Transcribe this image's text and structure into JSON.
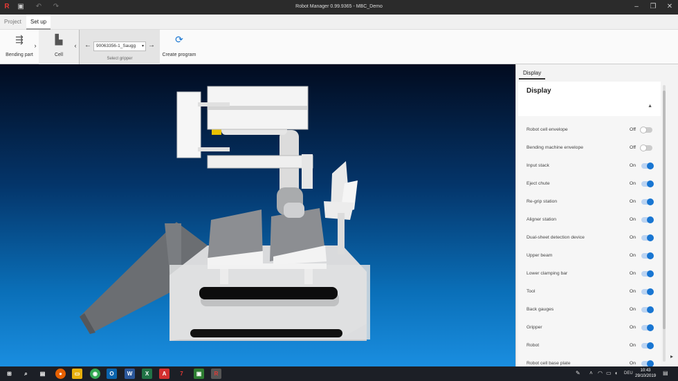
{
  "window": {
    "title": "Robot Manager 0.99.9365 - MBC_Demo"
  },
  "tabs": [
    {
      "label": "Project"
    },
    {
      "label": "Set up"
    }
  ],
  "ribbon": {
    "bending_part": "Bending part",
    "cell": "Cell",
    "gripper_value": "90063356-1_Saugg",
    "gripper_caption": "Select gripper",
    "create_program": "Create program"
  },
  "panel": {
    "tab": "Display",
    "title": "Display",
    "items": [
      {
        "label": "Robot cell envelope",
        "state": "Off",
        "on": false
      },
      {
        "label": "Bending machine envelope",
        "state": "Off",
        "on": false
      },
      {
        "label": "Input stack",
        "state": "On",
        "on": true
      },
      {
        "label": "Eject chute",
        "state": "On",
        "on": true
      },
      {
        "label": "Re-grip station",
        "state": "On",
        "on": true
      },
      {
        "label": "Aligner station",
        "state": "On",
        "on": true
      },
      {
        "label": "Dual-sheet detection device",
        "state": "On",
        "on": true
      },
      {
        "label": "Upper beam",
        "state": "On",
        "on": true
      },
      {
        "label": "Lower clamping bar",
        "state": "On",
        "on": true
      },
      {
        "label": "Tool",
        "state": "On",
        "on": true
      },
      {
        "label": "Back gauges",
        "state": "On",
        "on": true
      },
      {
        "label": "Gripper",
        "state": "On",
        "on": true
      },
      {
        "label": "Robot",
        "state": "On",
        "on": true
      },
      {
        "label": "Robot cell base plate",
        "state": "On",
        "on": true
      }
    ]
  },
  "taskbar": {
    "lang": "DEU",
    "time": "10:43",
    "date": "29/10/2019"
  }
}
